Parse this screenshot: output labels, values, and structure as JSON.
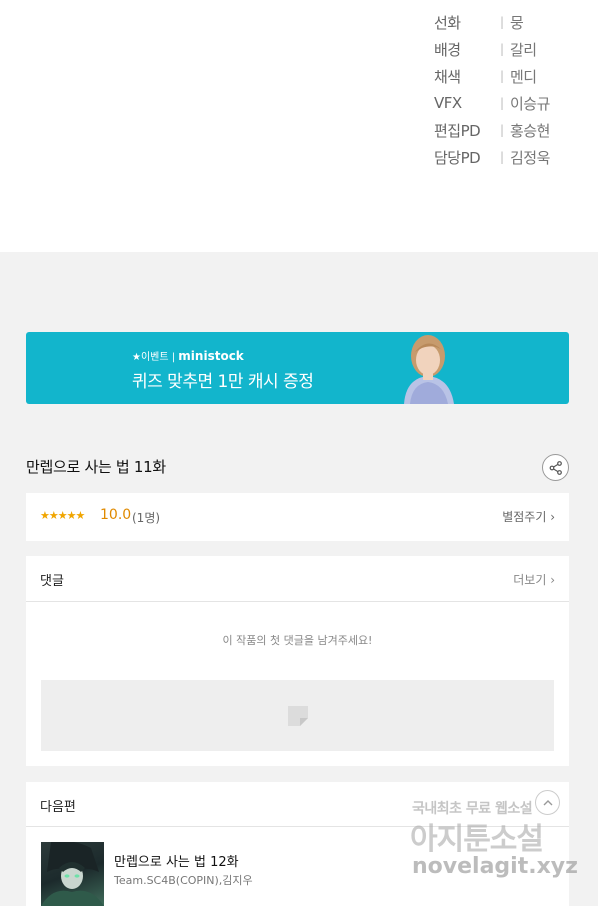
{
  "credits": [
    {
      "role": "선화",
      "name": "뭉"
    },
    {
      "role": "배경",
      "name": "갈리"
    },
    {
      "role": "채색",
      "name": "멘디"
    },
    {
      "role": "VFX",
      "name": "이승규"
    },
    {
      "role": "편집PD",
      "name": "홍승현"
    },
    {
      "role": "담당PD",
      "name": "김정욱"
    }
  ],
  "credit_separator": "|",
  "banner": {
    "tag_prefix": "★이벤트 | ",
    "tag_brand": "ministock",
    "text": "퀴즈 맞추면 1만 캐시 증정"
  },
  "episode": {
    "title": "만렙으로 사는 법 11화"
  },
  "rating": {
    "stars": "★★★★★",
    "score": "10.0",
    "votes": "(1명)",
    "rate_label": "별점주기 ›"
  },
  "comments": {
    "title": "댓글",
    "more_label": "더보기 ›",
    "empty_message": "이 작품의 첫 댓글을 남겨주세요!"
  },
  "next_episode": {
    "section_title": "다음편",
    "title": "만렙으로 사는 법 12화",
    "author": "Team.SC4B(COPIN),김지우"
  },
  "watermark": {
    "line1": "국내최초 무료 웹소설",
    "line2": "아지툰소설",
    "line3": "novelagit.xyz"
  },
  "colors": {
    "accent": "#12b5cc",
    "star": "#f0a500",
    "background": "#f2f2f2"
  }
}
